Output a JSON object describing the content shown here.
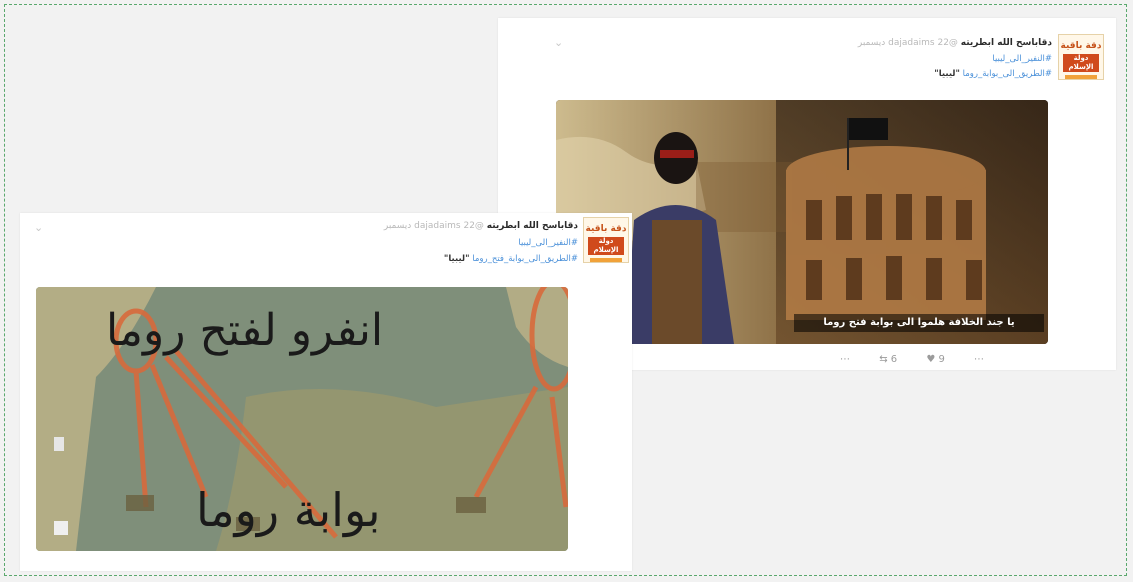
{
  "colors": {
    "page_bg": "#f2f2f2",
    "frame_border": "#5aa86d",
    "hashtag": "#4a90d9",
    "name": "#2b2b2b",
    "muted": "#b9b9b9",
    "avatar_accent": "#d04a1c"
  },
  "tweets": [
    {
      "avatar": {
        "line1": "دقة باقية",
        "line2": "دولة الإسلام",
        "icon": "account-avatar"
      },
      "name": "دقاباسح الله ابطريته",
      "handle": "@dajadaims",
      "time": "22 ديسمبر",
      "hashtag1": "#النفير_الى_ليبيا",
      "hashtag2": "#الطريق_الى_بوابة_روما",
      "quote": "\"ليبيا\"",
      "image_banner": "يا جند الخلافة هلموا الى بوابة فتح روما",
      "actions": {
        "reply_icon": "reply-icon",
        "retweet_count": "6",
        "like_count": "9"
      }
    },
    {
      "avatar": {
        "line1": "دقة باقية",
        "line2": "دولة الإسلام",
        "icon": "account-avatar"
      },
      "name": "دقاباسح الله ابطريته",
      "handle": "@dajadaims",
      "time": "22 ديسمبر",
      "hashtag1": "#النفير_الى_ليبيا",
      "hashtag2": "#الطريق_الى_بوابة_فتح_روما",
      "quote": "\"ليبيا\"",
      "map_text_1": "انفرو لفتح روما",
      "map_text_2": "بوابة روما"
    }
  ]
}
